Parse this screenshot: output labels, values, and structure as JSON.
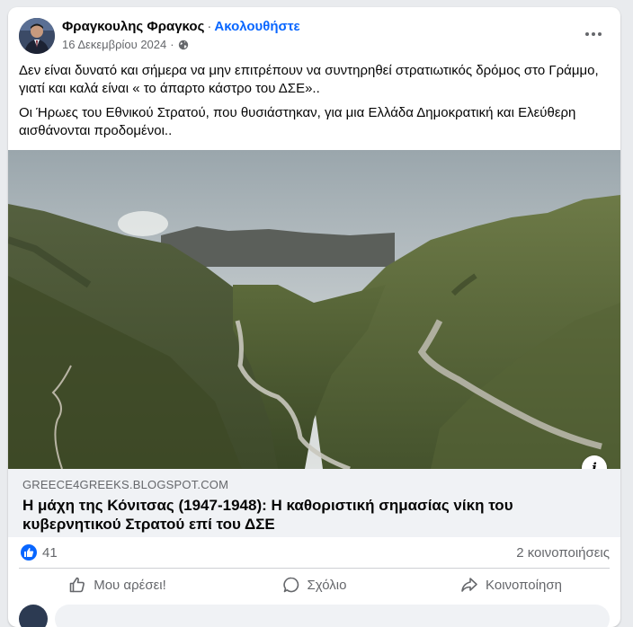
{
  "post": {
    "author": "Φραγκουλης Φραγκος",
    "separator": "·",
    "follow_label": "Ακολουθήστε",
    "date": "16 Δεκεμβρίου 2024",
    "date_separator": "·",
    "privacy_icon": "globe-icon",
    "more_icon": "more-options-icon",
    "paragraphs": [
      "Δεν είναι δυνατό και σήμερα να μην επιτρέπουν να συντηρηθεί στρατιωτικός δρόμος στο Γράμμο, γιατί και καλά είναι « το άπαρτο κάστρο του ΔΣΕ»..",
      "Οι Ήρωες του Εθνικού Στρατού, που θυσιάστηκαν, για μια Ελλάδα Δημοκρατική και Ελεύθερη αισθάνονται προδομένοι.."
    ]
  },
  "link": {
    "domain": "GREECE4GREEKS.BLOGSPOT.COM",
    "title": "Η μάχη της Κόνιτσας (1947-1948): Η καθοριστική σημασίας νίκη του κυβερνητικού Στρατού επί του ΔΣΕ",
    "info_label": "i"
  },
  "stats": {
    "reaction_icon": "like-reaction-icon",
    "likes": "41",
    "shares": "2 κοινοποιήσεις"
  },
  "actions": {
    "like": "Μου αρέσει!",
    "comment": "Σχόλιο",
    "share": "Κοινοποίηση"
  },
  "colors": {
    "accent": "#0866ff",
    "secondary_text": "#65676b",
    "link_bg": "#f0f2f5"
  }
}
